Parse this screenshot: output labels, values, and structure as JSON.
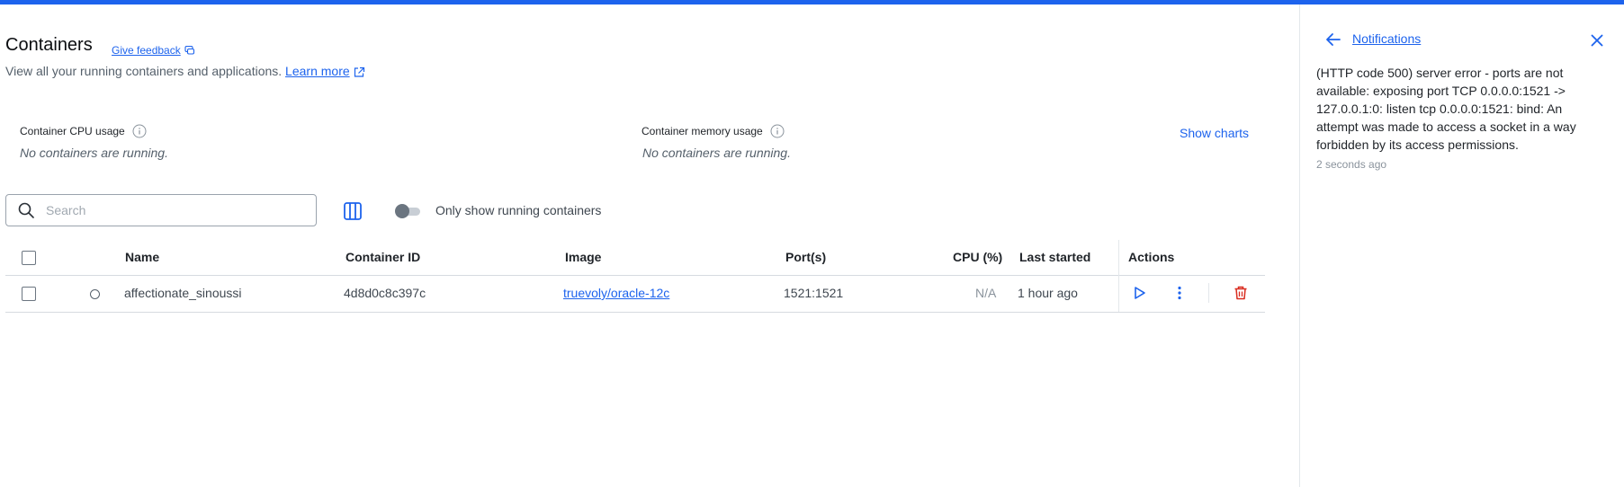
{
  "header": {
    "title": "Containers",
    "feedback_label": "Give feedback",
    "subtitle": "View all your running containers and applications.",
    "learn_more": "Learn more"
  },
  "stats": {
    "cpu_label": "Container CPU usage",
    "cpu_value": "No containers are running.",
    "memory_label": "Container memory usage",
    "memory_value": "No containers are running.",
    "show_charts": "Show charts"
  },
  "toolbar": {
    "search_placeholder": "Search",
    "search_value": "",
    "toggle_label": "Only show running containers",
    "toggle_on": false
  },
  "table": {
    "columns": [
      "Name",
      "Container ID",
      "Image",
      "Port(s)",
      "CPU (%)",
      "Last started",
      "Actions"
    ],
    "rows": [
      {
        "name": "affectionate_sinoussi",
        "container_id": "4d8d0c8c397c",
        "image": "truevoly/oracle-12c",
        "ports": "1521:1521",
        "cpu": "N/A",
        "last_started": "1 hour ago",
        "status": "stopped"
      }
    ]
  },
  "notifications": {
    "title": "Notifications",
    "message": "(HTTP code 500) server error - ports are not available: exposing port TCP 0.0.0.0:1521 -> 127.0.0.1:0: listen tcp 0.0.0.0:1521: bind: An attempt was made to access a socket in a way forbidden by its access permissions.",
    "time": "2 seconds ago"
  },
  "colors": {
    "accent": "#1d63ed",
    "danger": "#d92d20",
    "text": "#1f2328",
    "muted": "#55606b"
  },
  "icons": {
    "feedback": "chat-bubble-icon",
    "external": "external-link-icon",
    "info": "info-icon",
    "search": "search-icon",
    "columns": "columns-icon",
    "run": "play-icon",
    "more": "kebab-menu-icon",
    "delete": "trash-icon",
    "back": "arrow-left-icon",
    "close": "close-icon"
  }
}
